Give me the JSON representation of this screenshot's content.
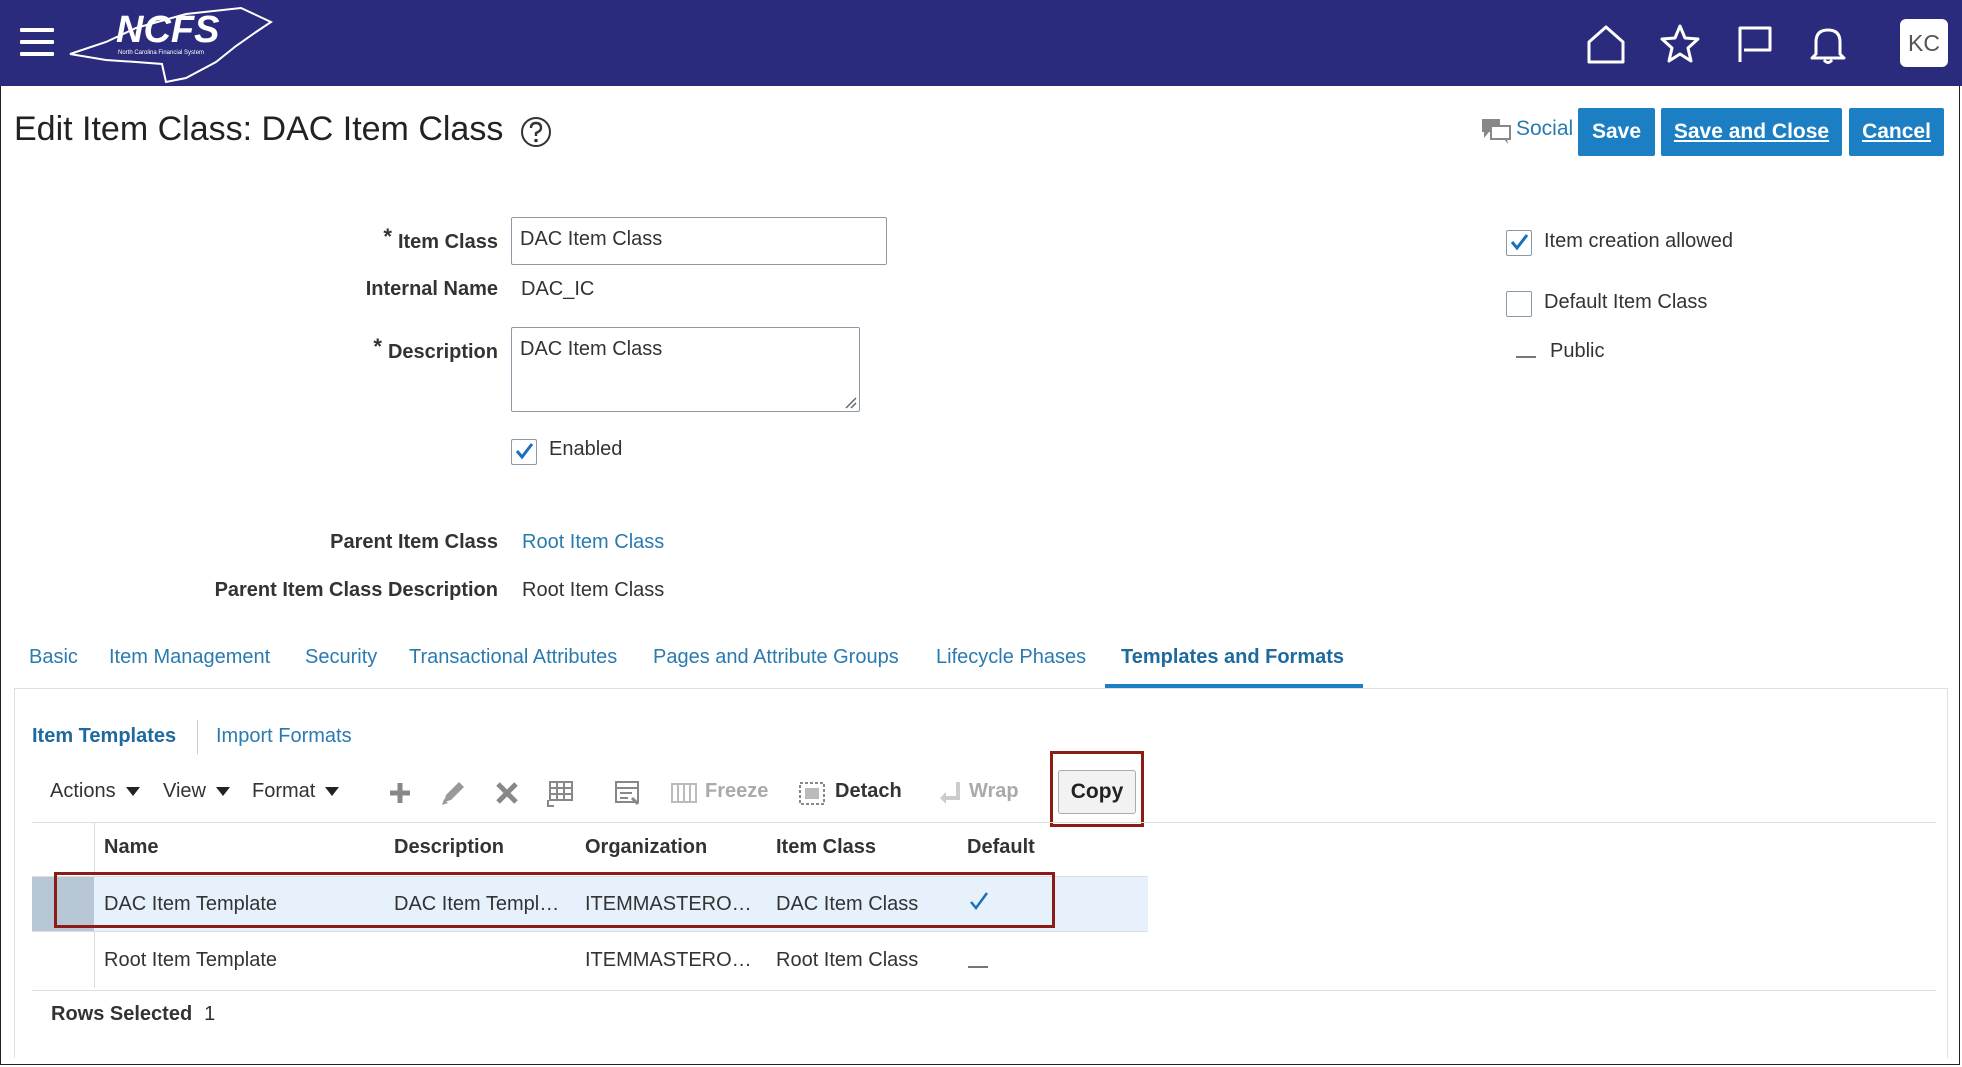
{
  "header": {
    "logo_text": "NCFS",
    "logo_subtext": "North Carolina Financial System",
    "avatar_initials": "KC"
  },
  "page": {
    "title": "Edit Item Class: DAC Item Class",
    "social_label": "Social",
    "save_label": "Save",
    "save_close_label": "Save and Close",
    "cancel_label": "Cancel"
  },
  "form": {
    "item_class_label": "Item Class",
    "item_class_value": "DAC Item Class",
    "internal_name_label": "Internal Name",
    "internal_name_value": "DAC_IC",
    "description_label": "Description",
    "description_value": "DAC Item Class",
    "enabled_label": "Enabled",
    "enabled_checked": true,
    "parent_item_class_label": "Parent Item Class",
    "parent_item_class_value": "Root Item Class",
    "parent_desc_label": "Parent Item Class Description",
    "parent_desc_value": "Root Item Class",
    "item_creation_allowed_label": "Item creation allowed",
    "item_creation_allowed_checked": true,
    "default_item_class_label": "Default Item Class",
    "default_item_class_checked": false,
    "public_label": "Public"
  },
  "tabs": [
    {
      "label": "Basic"
    },
    {
      "label": "Item Management"
    },
    {
      "label": "Security"
    },
    {
      "label": "Transactional Attributes"
    },
    {
      "label": "Pages and Attribute Groups"
    },
    {
      "label": "Lifecycle Phases"
    },
    {
      "label": "Templates and Formats",
      "active": true
    }
  ],
  "subtabs": [
    {
      "label": "Item Templates",
      "active": true
    },
    {
      "label": "Import Formats"
    }
  ],
  "toolbar": {
    "actions_label": "Actions",
    "view_label": "View",
    "format_label": "Format",
    "freeze_label": "Freeze",
    "detach_label": "Detach",
    "wrap_label": "Wrap",
    "copy_label": "Copy"
  },
  "table": {
    "columns": [
      "Name",
      "Description",
      "Organization",
      "Item Class",
      "Default"
    ],
    "rows": [
      {
        "name": "DAC Item Template",
        "description": "DAC Item Templ…",
        "organization": "ITEMMASTERO…",
        "item_class": "DAC Item Class",
        "default": true,
        "selected": true
      },
      {
        "name": "Root Item Template",
        "description": "",
        "organization": "ITEMMASTERO…",
        "item_class": "Root Item Class",
        "default": false,
        "selected": false
      }
    ],
    "rows_selected_label": "Rows Selected",
    "rows_selected_count": "1"
  },
  "colors": {
    "header_bg": "#2b2b7d",
    "button_blue": "#1c7fc4",
    "link_blue": "#2a7ab0",
    "highlight_red": "#8b1d14",
    "selected_row": "#e6f1fb"
  }
}
